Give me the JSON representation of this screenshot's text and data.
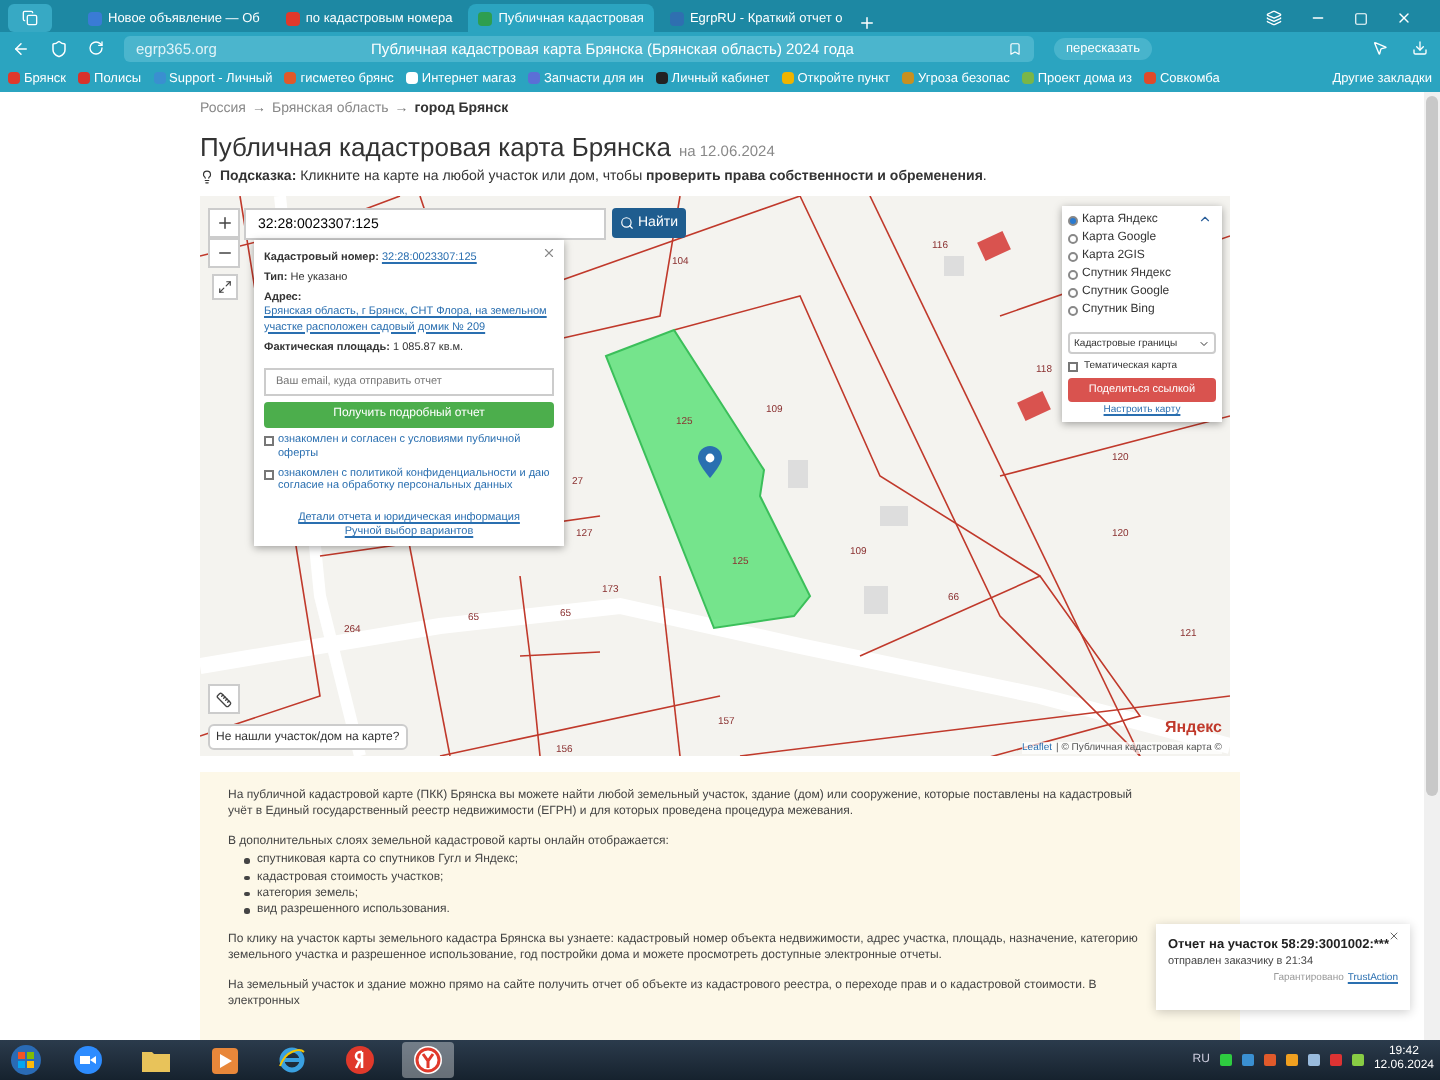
{
  "browser": {
    "tabs": [
      {
        "label": "Новое объявление — Об",
        "selected": false,
        "color": "#3a7bd5"
      },
      {
        "label": "по кадастровым номера",
        "selected": false,
        "color": "#e0392b"
      },
      {
        "label": "Публичная кадастровая",
        "selected": true,
        "color": "#2e9e4f"
      },
      {
        "label": "EgrpRU - Краткий отчет о",
        "selected": false,
        "color": "#2f6fb0"
      }
    ],
    "url": "egrp365.org",
    "page_title": "Публичная кадастровая карта Брянска (Брянская область) 2024 года",
    "retell_button": "пересказать",
    "bookmarks": [
      {
        "label": "Брянск",
        "color": "#e0392b"
      },
      {
        "label": "Полисы",
        "color": "#d8322b"
      },
      {
        "label": "Support - Личный",
        "color": "#3a8fd0"
      },
      {
        "label": "гисметео брянс",
        "color": "#e0592b"
      },
      {
        "label": "Интернет магаз",
        "color": "#ffffff"
      },
      {
        "label": "Запчасти для ин",
        "color": "#5b6fd6"
      },
      {
        "label": "Личный кабинет",
        "color": "#222222"
      },
      {
        "label": "Откройте пункт",
        "color": "#f0b400"
      },
      {
        "label": "Угроза безопас",
        "color": "#c89020"
      },
      {
        "label": "Проект дома из",
        "color": "#7ab648"
      },
      {
        "label": "Совкомба",
        "color": "#e04a2b"
      }
    ],
    "other_bookmarks": "Другие закладки"
  },
  "breadcrumb": [
    {
      "label": "Россия",
      "current": false,
      "separator": "→"
    },
    {
      "label": "Брянская область",
      "current": false,
      "separator": "→"
    },
    {
      "label": "город Брянск",
      "current": true
    }
  ],
  "title": "Публичная кадастровая карта Брянска",
  "title_date": "на 12.06.2024",
  "hint": "**Подсказка:** Кликните на карте на любой участок или дом, чтобы **проверить права собственности и обременения**.",
  "map": {
    "search_value": "32:28:0023307:125",
    "search_button": "Найти",
    "parcel_labels": [
      "104",
      "116",
      "125",
      "109",
      "125",
      "109",
      "118",
      "120",
      "120",
      "121",
      "66",
      "157",
      "156",
      "264",
      "65",
      "65",
      "127",
      "27",
      "173"
    ],
    "popup": {
      "fields": [
        {
          "label": "Кадастровый номер:",
          "value": "32:28:0023307:125",
          "kind": "link"
        },
        {
          "label": "Тип:",
          "value": "Не указано",
          "kind": "text"
        },
        {
          "label": "Адрес:",
          "value": "Брянская область, г Брянск, СНТ Флора, на земельном участке расположен садовый домик № 209",
          "kind": "link"
        },
        {
          "label": "Фактическая площадь:",
          "value": "1 085.87 кв.м.",
          "kind": "text"
        }
      ],
      "email_placeholder": "Ваш email, куда отправить отчет",
      "submit": "Получить подробный отчет",
      "consents": [
        {
          "label": "ознакомлен и согласен с условиями публичной оферты",
          "checked": false
        },
        {
          "label": "ознакомлен с политикой конфиденциальности и даю согласие на обработку персональных данных",
          "checked": false
        }
      ],
      "links": [
        "Детали отчета и юридическая информация",
        "Ручной выбор вариантов"
      ]
    },
    "not_found": "Не нашли участок/дом на карте?",
    "layers": [
      {
        "label": "Карта Яндекс",
        "selected": true
      },
      {
        "label": "Карта Google",
        "selected": false
      },
      {
        "label": "Карта 2GIS",
        "selected": false
      },
      {
        "label": "Спутник Яндекс",
        "selected": false
      },
      {
        "label": "Спутник Google",
        "selected": false
      },
      {
        "label": "Спутник Bing",
        "selected": false
      }
    ],
    "overlay_select": "Кадастровые границы",
    "thematic": {
      "label": "Тематическая карта",
      "checked": false
    },
    "share_button": "Поделиться ссылкой",
    "configure_link": "Настроить карту",
    "provider": "Яндекс",
    "attribution_link": "Leaflet",
    "attribution": "| © Публичная кадастровая карта ©"
  },
  "article": [
    {
      "kind": "paragraph",
      "text": "На публичной кадастровой карте (ПКК) Брянска вы можете найти любой земельный участок, здание (дом) или сооружение, которые поставлены на кадастровый учёт в Единый государственный реестр недвижимости (ЕГРН) и для которых проведена процедура межевания."
    },
    {
      "kind": "paragraph",
      "text": "В дополнительных слоях земельной кадастровой карты онлайн отображается:"
    },
    {
      "kind": "list",
      "items": [
        "спутниковая карта со спутников Гугл и Яндекс;",
        "кадастровая стоимость участков;",
        "категория земель;",
        "вид разрешенного использования."
      ]
    },
    {
      "kind": "paragraph",
      "text": "По клику на участок карты земельного кадастра Брянска вы узнаете: кадастровый номер объекта недвижимости, адрес участка, площадь, назначение, категорию земельного участка и разрешенное использование, год постройки дома и можете просмотреть доступные электронные отчеты."
    },
    {
      "kind": "paragraph",
      "text": "На земельный участок и здание можно прямо на сайте получить отчет об объекте из кадастрового реестра, о переходе прав и о кадастровой стоимости. В электронных"
    }
  ],
  "notification": {
    "title": "Отчет на участок 58:29:3001002:***",
    "text": "отправлен заказчику в 21:34",
    "guarantee": "Гарантировано",
    "brand": "TrustAction"
  },
  "taskbar": {
    "apps": [
      {
        "kind": "start",
        "active": false
      },
      {
        "kind": "video",
        "active": false
      },
      {
        "kind": "folder",
        "active": false
      },
      {
        "kind": "media",
        "active": false
      },
      {
        "kind": "ie",
        "active": false
      },
      {
        "kind": "yandex",
        "active": false
      },
      {
        "kind": "ybrowser",
        "active": true
      }
    ],
    "language": "RU",
    "time": "19:42",
    "date": "12.06.2024"
  }
}
